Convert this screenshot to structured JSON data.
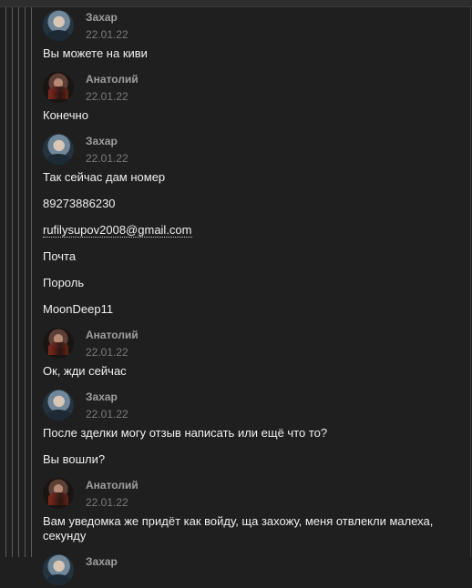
{
  "messages": [
    {
      "author": "Захар",
      "date": "22.01.22",
      "avatar": "zakhar",
      "lines": [
        "Вы можете на киви"
      ]
    },
    {
      "author": "Анатолий",
      "date": "22.01.22",
      "avatar": "anatoly",
      "lines": [
        "Конечно"
      ]
    },
    {
      "author": "Захар",
      "date": "22.01.22",
      "avatar": "zakhar",
      "lines": [
        "Так сейчас дам номер",
        "89273886230",
        "rufilysupov2008@gmail.com",
        "Почта",
        "Пороль",
        "MoonDeep11"
      ]
    },
    {
      "author": "Анатолий",
      "date": "22.01.22",
      "avatar": "anatoly",
      "lines": [
        "Ок, жди сейчас"
      ]
    },
    {
      "author": "Захар",
      "date": "22.01.22",
      "avatar": "zakhar",
      "lines": [
        "После зделки могу отзыв написать или ещё что то?",
        "Вы вошли?"
      ]
    },
    {
      "author": "Анатолий",
      "date": "22.01.22",
      "avatar": "anatoly",
      "lines": [
        "Вам уведомка же придёт как войду, ща захожу, меня отвлекли малеха, секунду"
      ]
    },
    {
      "author": "Захар",
      "date": "",
      "avatar": "zakhar",
      "lines": []
    }
  ]
}
